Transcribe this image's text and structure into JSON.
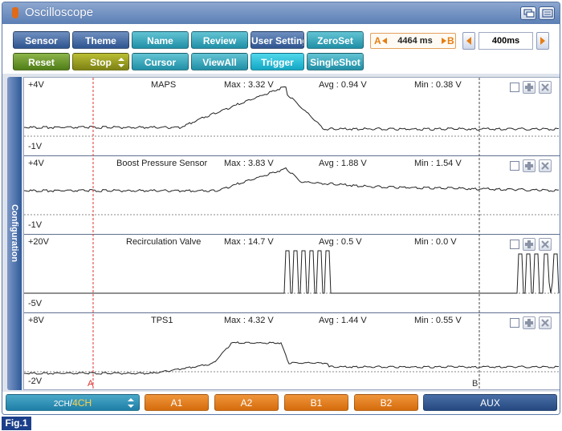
{
  "window": {
    "title": "Oscilloscope"
  },
  "toolbar": {
    "row1": [
      "Sensor",
      "Theme",
      "Name",
      "Review",
      "User Setting",
      "ZeroSet"
    ],
    "row2": [
      "Reset",
      "Stop",
      "Cursor",
      "ViewAll",
      "Trigger",
      "SingleShot"
    ]
  },
  "cursor_interval": {
    "a_label": "A",
    "b_label": "B",
    "value": "4464 ms"
  },
  "time_div": {
    "value": "400ms"
  },
  "side_tab": {
    "label": "Configuration"
  },
  "channels": [
    {
      "top": "+4V",
      "bottom": "-1V",
      "name": "MAPS",
      "max": "Max : 3.32 V",
      "avg": "Avg : 0.94 V",
      "min": "Min : 0.38 V"
    },
    {
      "top": "+4V",
      "bottom": "-1V",
      "name": "Boost Pressure Sensor",
      "max": "Max : 3.83 V",
      "avg": "Avg : 1.88 V",
      "min": "Min : 1.54 V"
    },
    {
      "top": "+20V",
      "bottom": "-5V",
      "name": "Recirculation Valve",
      "max": "Max : 14.7 V",
      "avg": "Avg : 0.5 V",
      "min": "Min : 0.0 V"
    },
    {
      "top": "+8V",
      "bottom": "-2V",
      "name": "TPS1",
      "max": "Max : 4.32 V",
      "avg": "Avg : 1.44 V",
      "min": "Min : 0.55 V"
    }
  ],
  "cursors": {
    "a": "A",
    "b": "B"
  },
  "bottom_bar": {
    "ch2": "2CH",
    "separator": "/",
    "ch4": "4CH",
    "buttons": [
      "A1",
      "A2",
      "B1",
      "B2",
      "AUX"
    ]
  },
  "figure_label": "Fig.1",
  "colors": {
    "accent_orange": "#e67e12",
    "cursor_a": "#e03030",
    "frame_blue": "#5a78a8"
  }
}
